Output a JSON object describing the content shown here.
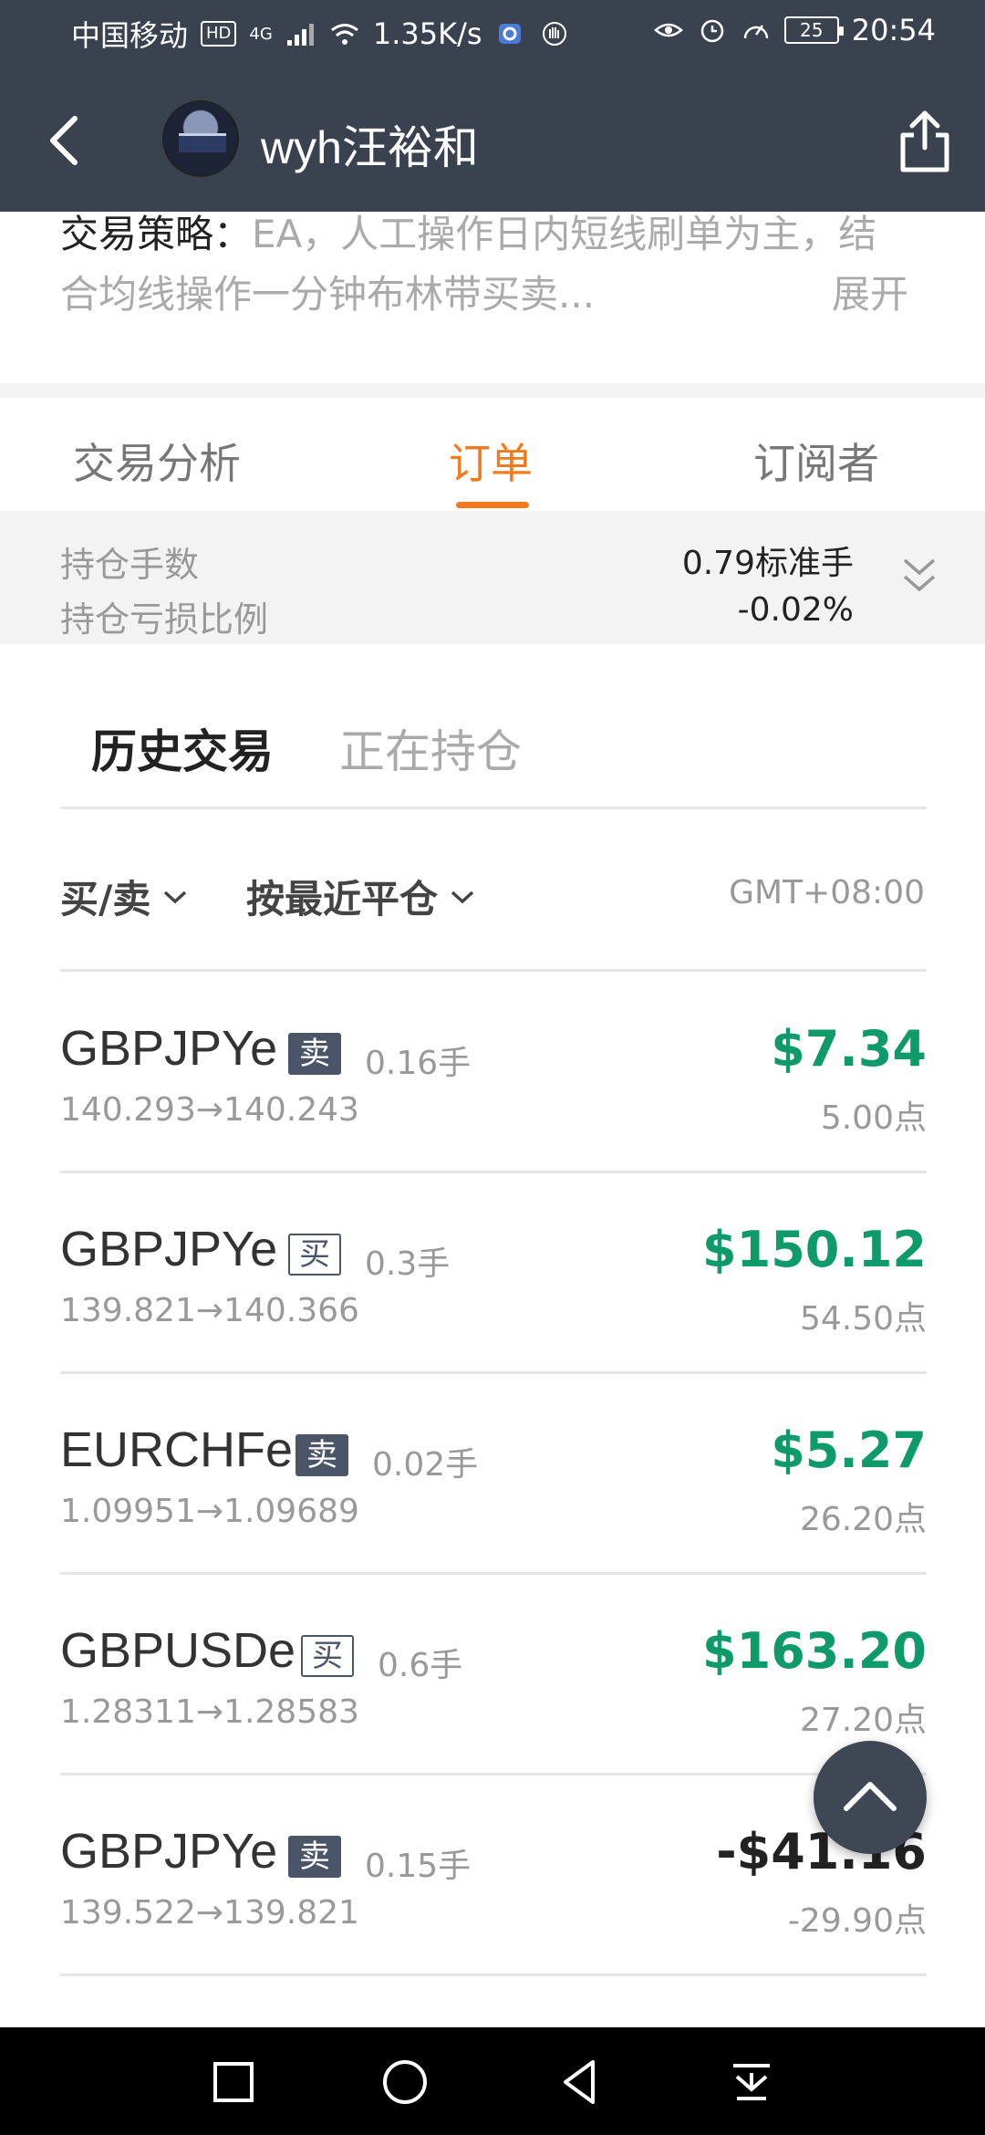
{
  "status_bar": {
    "carrier": "中国移动",
    "hd": "HD",
    "network": "4G",
    "speed": "1.35K/s",
    "battery": "25",
    "time": "20:54"
  },
  "header": {
    "username": "wyh汪裕和"
  },
  "strategy": {
    "label": "交易策略：",
    "text": "EA，人工操作日内短线刷单为主，结合均线操作一分钟布林带买卖...",
    "expand": "展开"
  },
  "tabs": [
    {
      "label": "交易分析"
    },
    {
      "label": "订单"
    },
    {
      "label": "订阅者"
    }
  ],
  "summary": {
    "position_label": "持仓手数",
    "position_value": "0.79标准手",
    "loss_label": "持仓亏损比例",
    "loss_value": "-0.02%"
  },
  "subtabs": [
    {
      "label": "历史交易"
    },
    {
      "label": "正在持仓"
    }
  ],
  "filters": {
    "side": "买/卖",
    "sort": "按最近平仓",
    "timezone": "GMT+08:00"
  },
  "orders": [
    {
      "symbol": "GBPJPYe",
      "side": "卖",
      "lots": "0.16手",
      "prices": "140.293→140.243",
      "pnl": "$7.34",
      "points": "5.00点"
    },
    {
      "symbol": "GBPJPYe",
      "side": "买",
      "lots": "0.3手",
      "prices": "139.821→140.366",
      "pnl": "$150.12",
      "points": "54.50点"
    },
    {
      "symbol": "EURCHFe",
      "side": "卖",
      "lots": "0.02手",
      "prices": "1.09951→1.09689",
      "pnl": "$5.27",
      "points": "26.20点"
    },
    {
      "symbol": "GBPUSDe",
      "side": "买",
      "lots": "0.6手",
      "prices": "1.28311→1.28583",
      "pnl": "$163.20",
      "points": "27.20点"
    },
    {
      "symbol": "GBPJPYe",
      "side": "卖",
      "lots": "0.15手",
      "prices": "139.522→139.821",
      "pnl": "-$41.16",
      "points": "-29.90点"
    }
  ],
  "colors": {
    "header_bg": "#3b424f",
    "accent": "#f07b1f",
    "profit": "#0f9a6a"
  }
}
